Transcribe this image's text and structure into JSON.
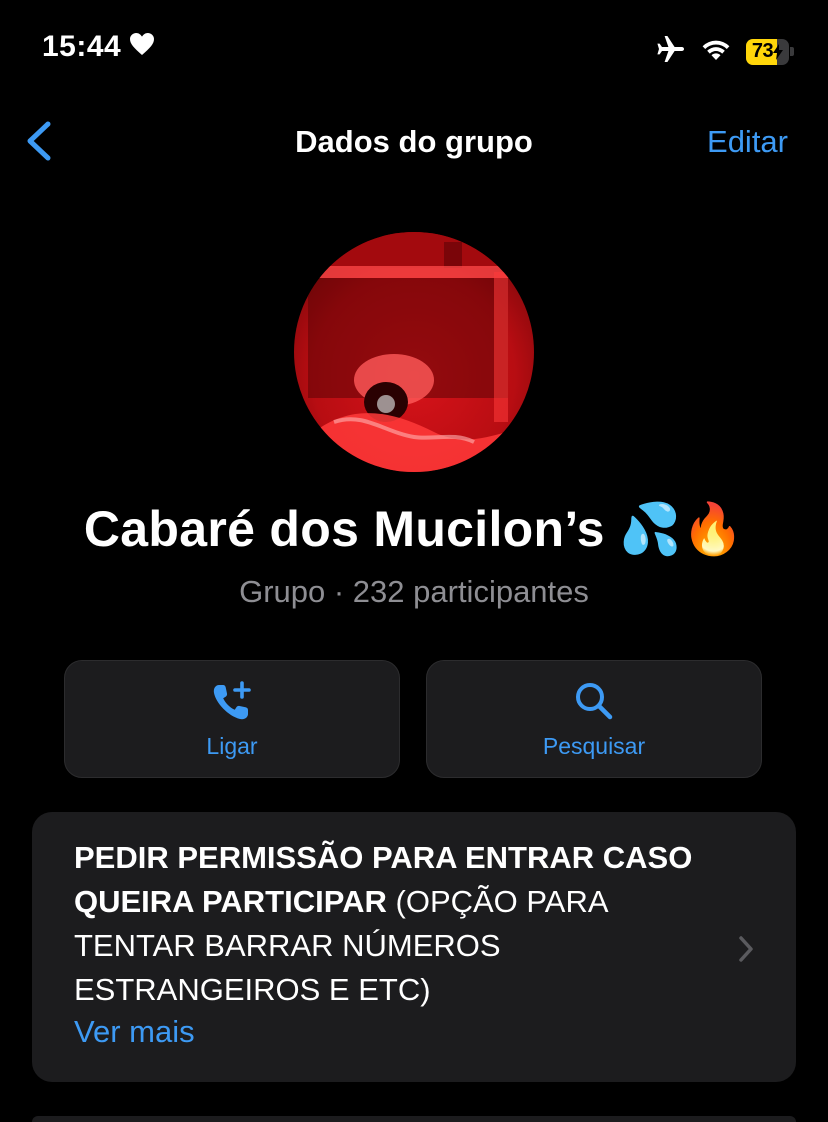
{
  "status_bar": {
    "time": "15:44",
    "battery_level": "73",
    "battery_fraction": 0.73,
    "battery_color": "#ffd60a",
    "icons": [
      "heart-icon",
      "airplane-icon",
      "wifi-icon",
      "battery-charging-icon"
    ]
  },
  "nav": {
    "title": "Dados do grupo",
    "edit_label": "Editar",
    "back_icon": "chevron-left-icon"
  },
  "group": {
    "name": "Cabaré dos Mucilon’s 💦🔥",
    "subtitle": "Grupo · 232 participantes"
  },
  "actions": [
    {
      "label": "Ligar",
      "icon": "phone-add-icon"
    },
    {
      "label": "Pesquisar",
      "icon": "search-icon"
    }
  ],
  "description": {
    "bold_text": "PEDIR PERMISSÃO PARA ENTRAR CASO QUEIRA PARTICIPAR",
    "rest_text": " (OPÇÃO PARA TENTAR BARRAR NÚMEROS ESTRANGEIROS E ETC)",
    "more_label": "Ver mais"
  },
  "colors": {
    "accent": "#3d9af4",
    "background": "#000000",
    "card": "#1c1c1e",
    "secondary_text": "#8e8e93"
  }
}
